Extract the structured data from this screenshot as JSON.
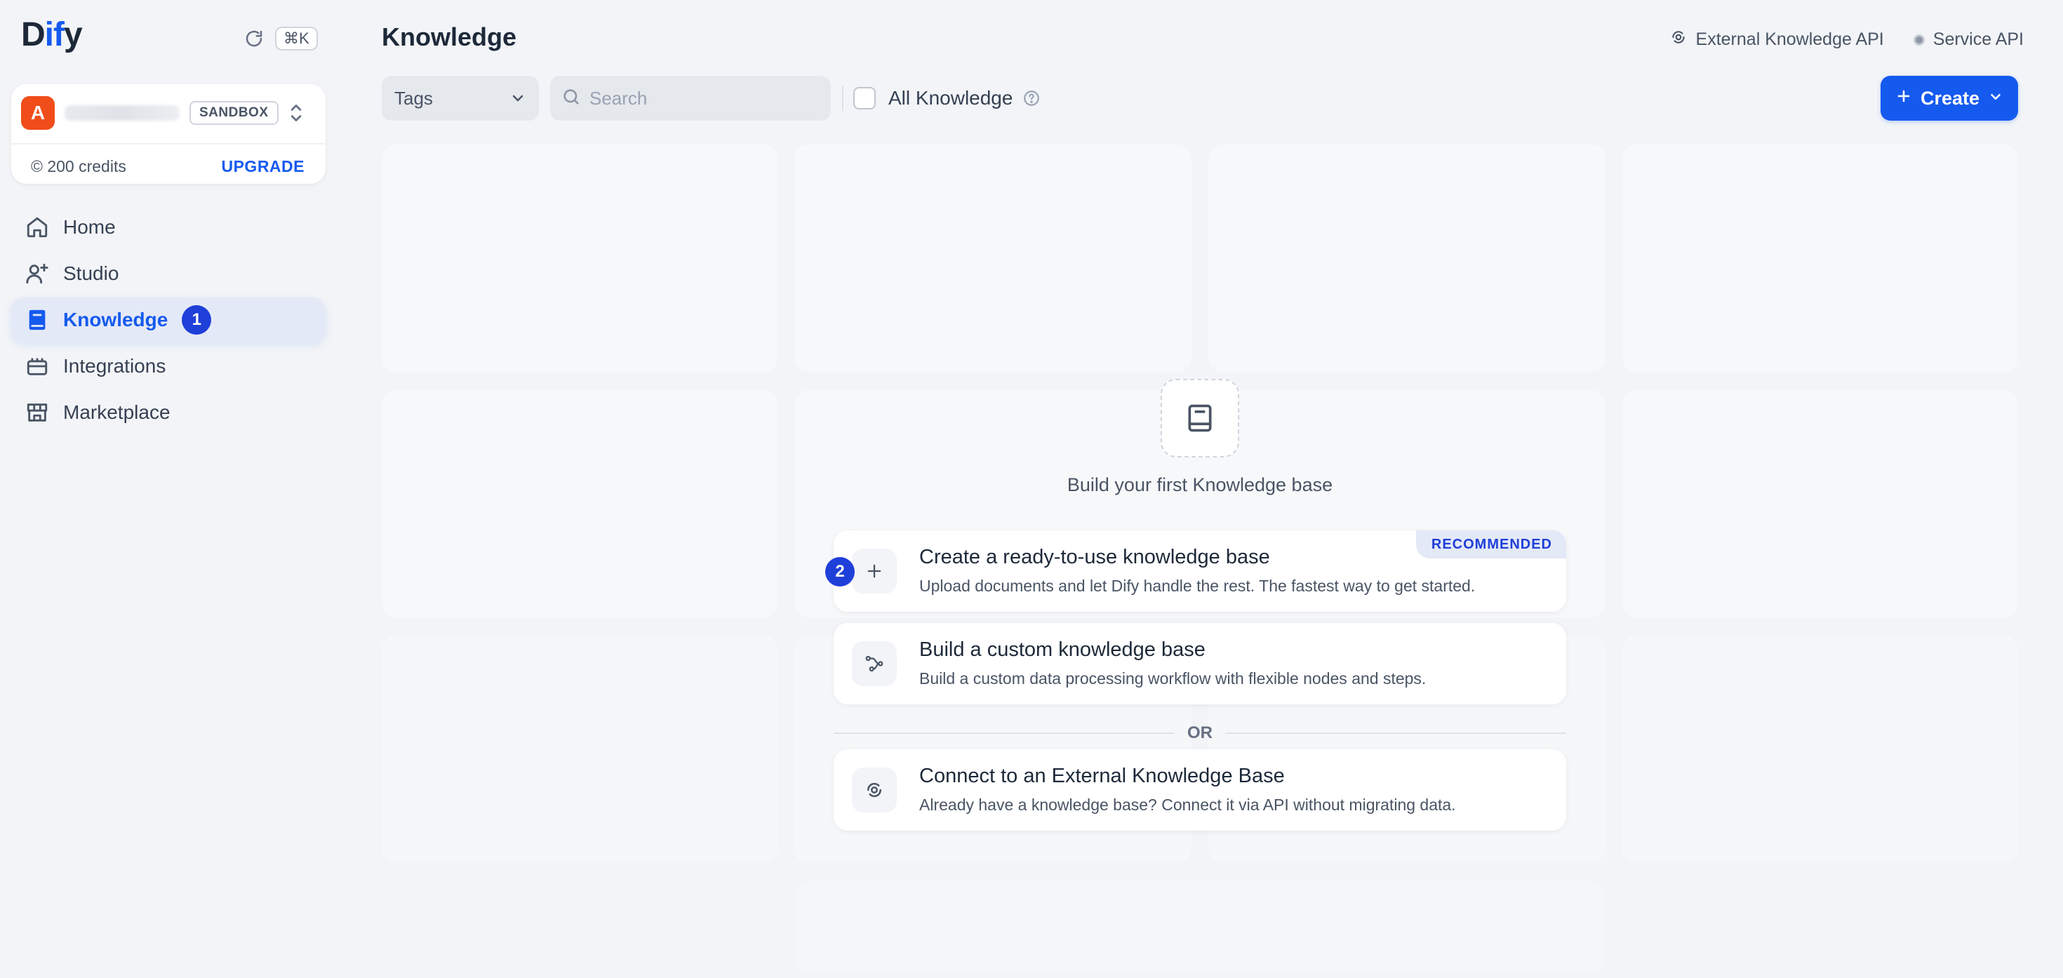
{
  "app": {
    "logo_prefix": "D",
    "logo_accent": "if",
    "logo_suffix": "y",
    "shortcut": "⌘K"
  },
  "workspace": {
    "avatar_letter": "A",
    "plan": "SANDBOX",
    "credits": "© 200 credits",
    "upgrade": "UPGRADE"
  },
  "nav": {
    "items": [
      {
        "label": "Home",
        "icon": "home-icon"
      },
      {
        "label": "Studio",
        "icon": "studio-icon"
      },
      {
        "label": "Knowledge",
        "icon": "knowledge-icon",
        "active": true,
        "badge": "1"
      },
      {
        "label": "Integrations",
        "icon": "integrations-icon"
      },
      {
        "label": "Marketplace",
        "icon": "marketplace-icon"
      }
    ]
  },
  "page": {
    "title": "Knowledge",
    "external_api": "External Knowledge API",
    "service_api": "Service API"
  },
  "toolbar": {
    "tags": "Tags",
    "search_placeholder": "Search",
    "all_knowledge": "All Knowledge",
    "create": "Create"
  },
  "empty": {
    "title": "Build your first Knowledge base",
    "options": [
      {
        "title": "Create a ready-to-use knowledge base",
        "desc": "Upload documents and let Dify handle the rest. The fastest way to get started.",
        "badge": "RECOMMENDED",
        "step": "2",
        "icon": "plus-icon"
      },
      {
        "title": "Build a custom knowledge base",
        "desc": "Build a custom data processing workflow with flexible nodes and steps.",
        "icon": "workflow-icon"
      },
      {
        "title": "Connect to an External Knowledge Base",
        "desc": "Already have a knowledge base? Connect it via API without migrating data.",
        "icon": "external-api-icon"
      }
    ],
    "or": "OR"
  },
  "colors": {
    "accent": "#155aef",
    "avatar": "#f04d1a",
    "badge": "#1f3fd9",
    "background": "#f2f4f7"
  }
}
